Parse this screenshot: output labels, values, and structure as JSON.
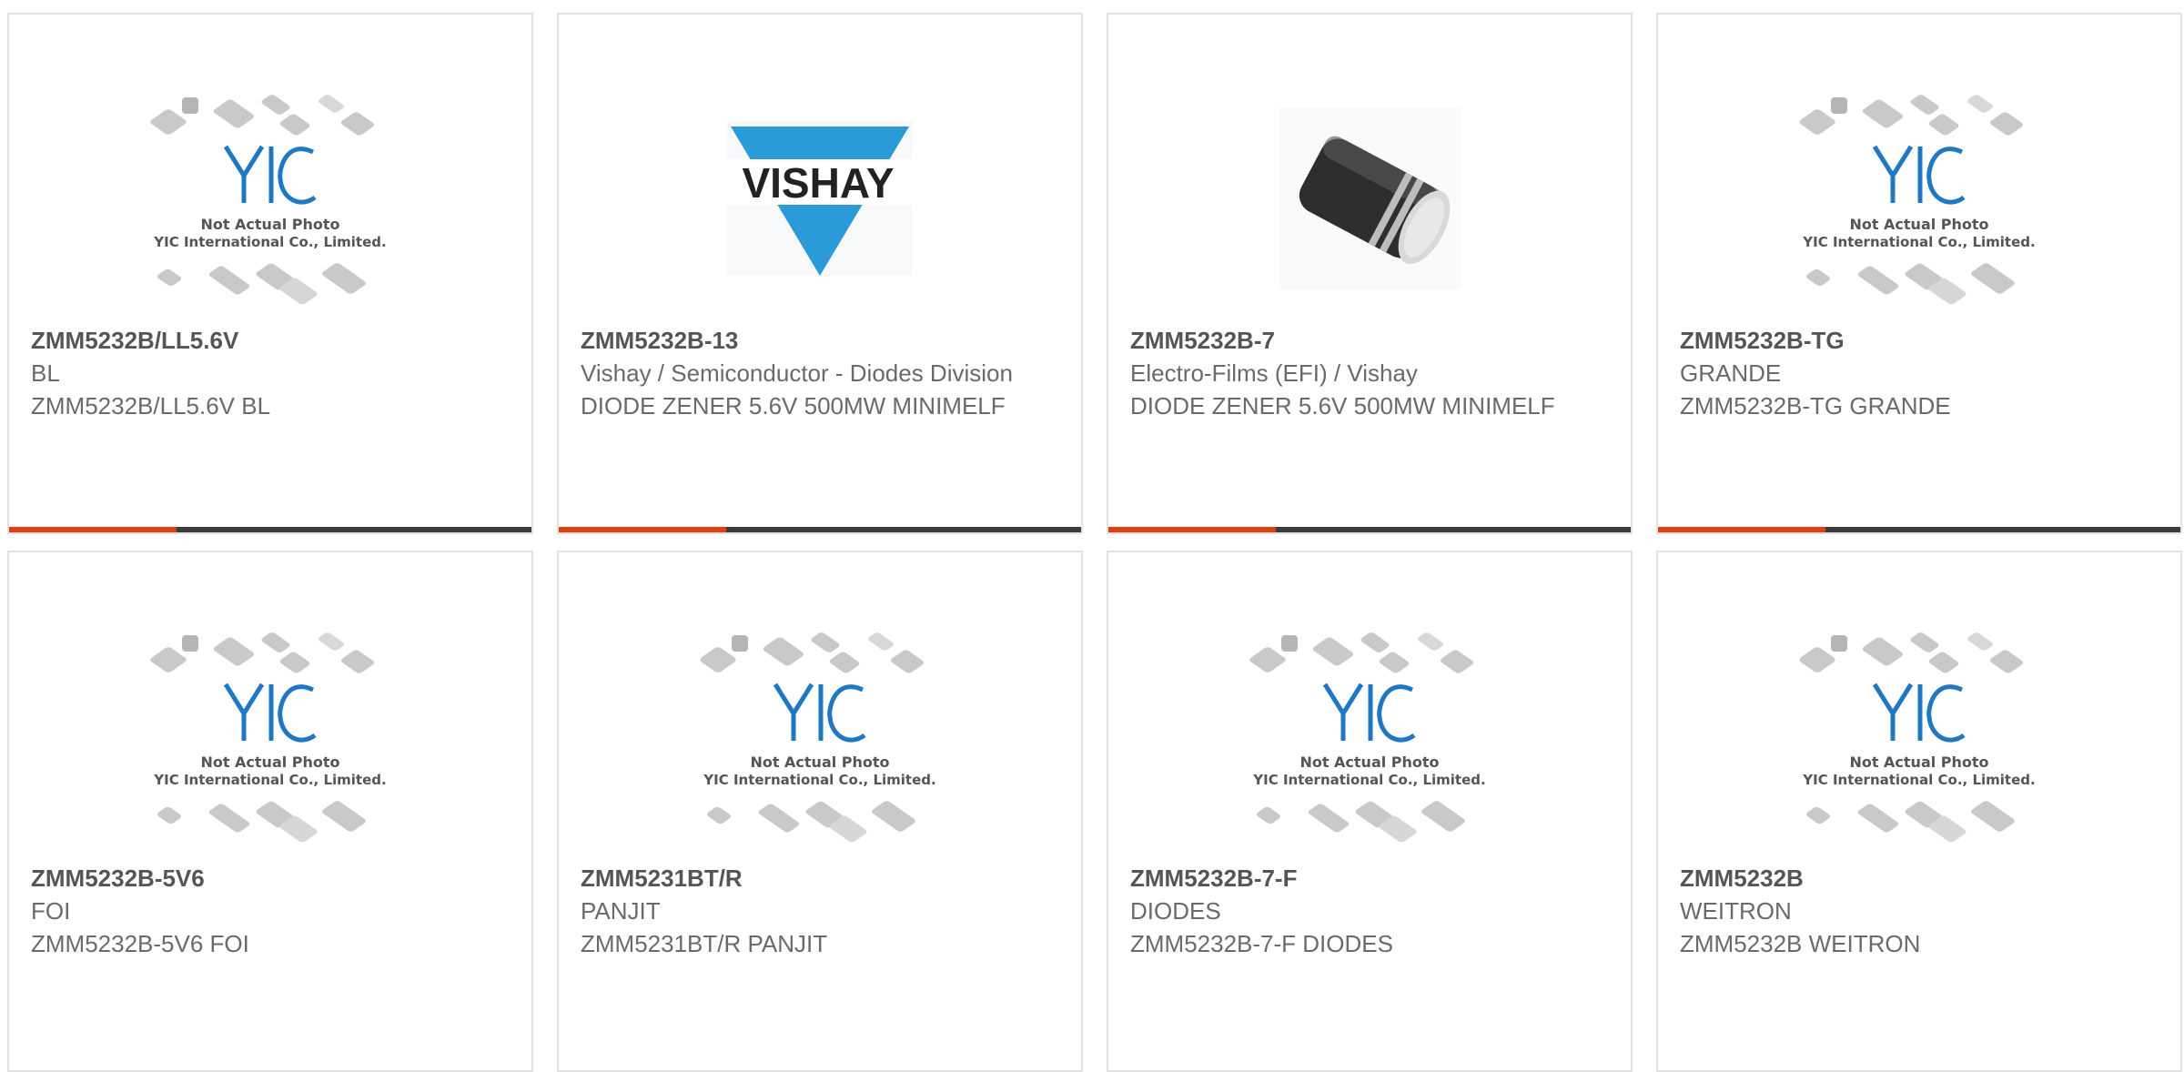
{
  "products": [
    {
      "part": "ZMM5232B/LL5.6V",
      "maker": "BL",
      "desc": "ZMM5232B/LL5.6V BL",
      "image": "placeholder"
    },
    {
      "part": "ZMM5232B-13",
      "maker": "Vishay / Semiconductor - Diodes Division",
      "desc": "DIODE ZENER 5.6V 500MW MINIMELF",
      "image": "vishay-logo"
    },
    {
      "part": "ZMM5232B-7",
      "maker": "Electro-Films (EFI) / Vishay",
      "desc": "DIODE ZENER 5.6V 500MW MINIMELF",
      "image": "minimelf-photo"
    },
    {
      "part": "ZMM5232B-TG",
      "maker": "GRANDE",
      "desc": "ZMM5232B-TG GRANDE",
      "image": "placeholder"
    },
    {
      "part": "ZMM5232B-5V6",
      "maker": "FOI",
      "desc": "ZMM5232B-5V6 FOI",
      "image": "placeholder"
    },
    {
      "part": "ZMM5231BT/R",
      "maker": "PANJIT",
      "desc": "ZMM5231BT/R PANJIT",
      "image": "placeholder"
    },
    {
      "part": "ZMM5232B-7-F",
      "maker": "DIODES",
      "desc": "ZMM5232B-7-F DIODES",
      "image": "placeholder"
    },
    {
      "part": "ZMM5232B",
      "maker": "WEITRON",
      "desc": "ZMM5232B WEITRON",
      "image": "placeholder"
    }
  ],
  "placeholder": {
    "line1": "Not Actual Photo",
    "line2": "YIC International Co., Limited."
  },
  "vishay_logo_text": "VISHAY",
  "colors": {
    "accent": "#e04012",
    "bar": "#3c3c3c",
    "yic_blue": "#1f78c1",
    "vishay_blue": "#2a9bd7"
  }
}
